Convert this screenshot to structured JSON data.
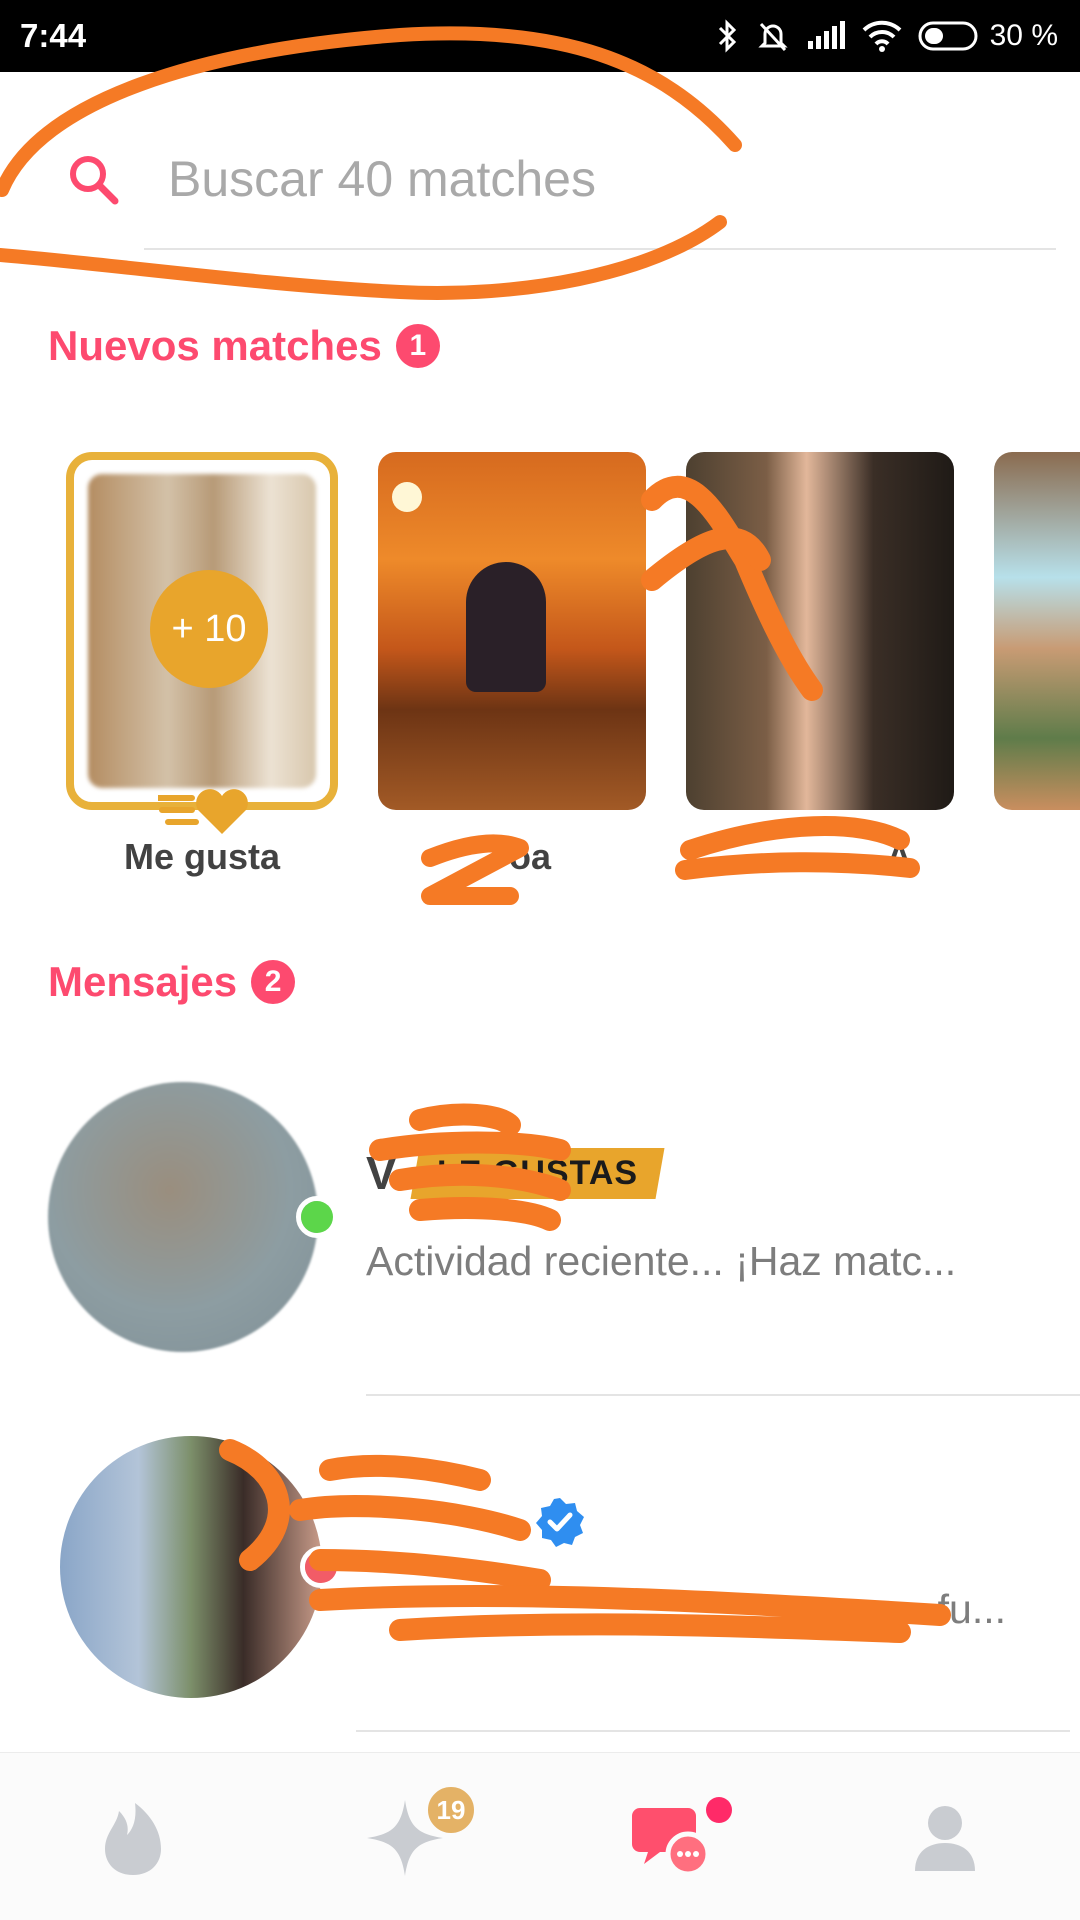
{
  "status_bar": {
    "time": "7:44",
    "battery": "30 %"
  },
  "search": {
    "placeholder": "Buscar 40 matches"
  },
  "new_matches": {
    "title": "Nuevos matches",
    "count": "1",
    "likes_card": {
      "count_label": "+ 10",
      "label": "Me gusta"
    },
    "cards": [
      {
        "label": "oa"
      },
      {
        "label": "A"
      }
    ]
  },
  "messages": {
    "title": "Mensajes",
    "count": "2",
    "items": [
      {
        "name": "V",
        "tag": "LE GUSTAS",
        "preview": "Actividad reciente... ¡Haz matc...",
        "status_color": "#5cd64a"
      },
      {
        "name": "",
        "verified": true,
        "preview": "fu...",
        "status_color": "#f25c67"
      }
    ]
  },
  "bottom_nav": {
    "items": [
      {
        "icon": "flame-icon"
      },
      {
        "icon": "sparkle-icon",
        "badge": "19"
      },
      {
        "icon": "chat-bubbles-icon",
        "active": true
      },
      {
        "icon": "profile-icon"
      }
    ]
  },
  "colors": {
    "accent": "#fd4a6f",
    "gold": "#e8a52c",
    "scribble": "#f57a25"
  }
}
